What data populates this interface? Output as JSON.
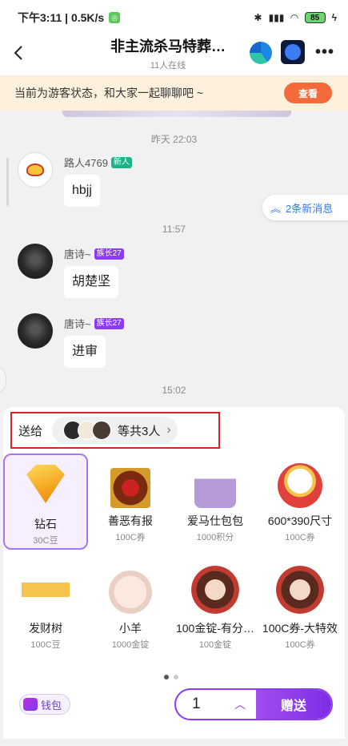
{
  "status_bar": {
    "time_speed": "下午3:11 | 0.5K/s",
    "battery": "85"
  },
  "header": {
    "title": "非主流杀马特葬…",
    "online": "11人在线"
  },
  "guest_banner": {
    "text": "当前为游客状态，和大家一起聊聊吧 ~",
    "button": "查看"
  },
  "chat": {
    "times": [
      "昨天 22:03",
      "11:57",
      "15:02"
    ],
    "messages": [
      {
        "name": "路人4769",
        "badge": "新人",
        "text": "hbjj"
      },
      {
        "name": "唐诗~",
        "badge": "族长27",
        "text": "胡楚坚"
      },
      {
        "name": "唐诗~",
        "badge": "族长27",
        "text": "进审"
      }
    ],
    "new_messages": "2条新消息"
  },
  "send_to": {
    "label": "送给",
    "summary": "等共3人"
  },
  "gifts": [
    {
      "name": "钻石",
      "price": "30C豆",
      "icon": "diamond-icon"
    },
    {
      "name": "善恶有报",
      "price": "100C券",
      "icon": "frame-icon"
    },
    {
      "name": "爱马仕包包",
      "price": "1000积分",
      "icon": "handbag-icon"
    },
    {
      "name": "600*390尺寸",
      "price": "100C券",
      "icon": "lucky-cat-icon"
    },
    {
      "name": "发财树",
      "price": "100C豆",
      "icon": "sign-icon"
    },
    {
      "name": "小羊",
      "price": "1000金锭",
      "icon": "bear-icon"
    },
    {
      "name": "100金锭-有分…",
      "price": "100金锭",
      "icon": "girl-icon"
    },
    {
      "name": "100C券-大特效",
      "price": "100C券",
      "icon": "girl-icon"
    }
  ],
  "footer": {
    "wallet": "钱包",
    "quantity": "1",
    "send": "赠送"
  }
}
